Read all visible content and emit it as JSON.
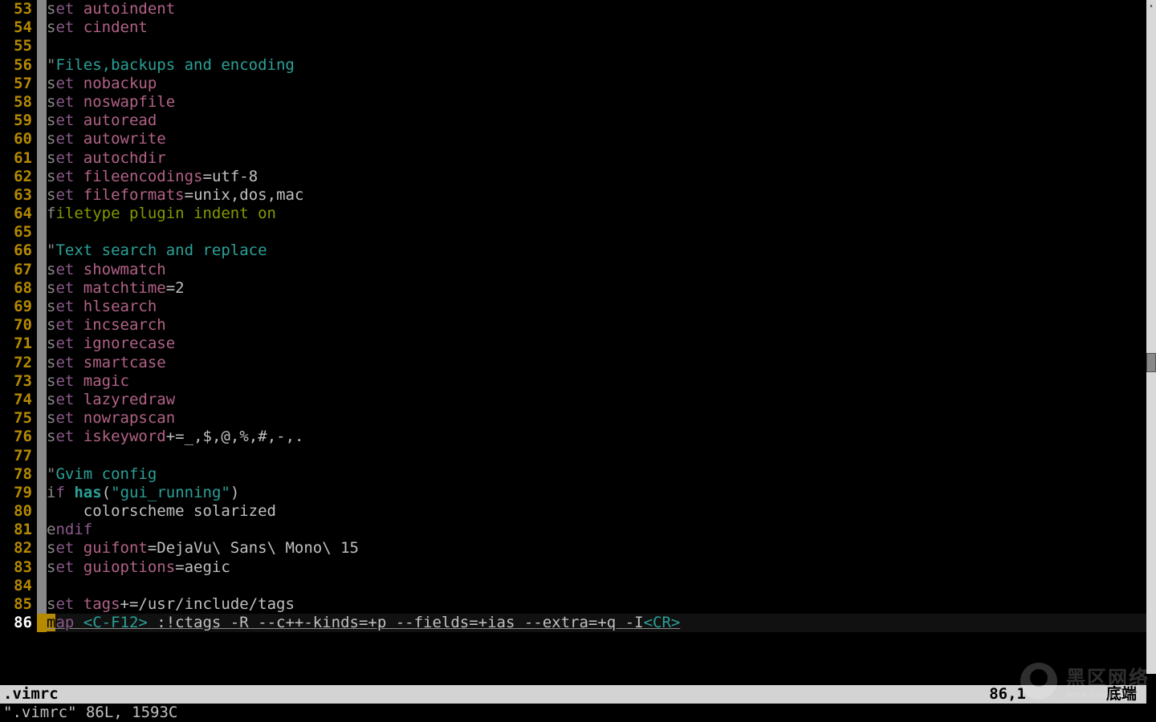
{
  "status": {
    "filename": ".vimrc",
    "position": "86,1",
    "mode": "底端"
  },
  "message": "\".vimrc\" 86L, 1593C",
  "watermark": {
    "line1": "黑区网络",
    "line2": "www.heiqu.com"
  },
  "lines": [
    {
      "n": 53,
      "tokens": [
        [
          "s",
          "fc"
        ],
        [
          "et ",
          "set"
        ],
        [
          "autoindent",
          "option"
        ]
      ]
    },
    {
      "n": 54,
      "tokens": [
        [
          "s",
          "fc"
        ],
        [
          "et ",
          "set"
        ],
        [
          "cindent",
          "option"
        ]
      ]
    },
    {
      "n": 55,
      "tokens": []
    },
    {
      "n": 56,
      "tokens": [
        [
          "\"",
          "fc"
        ],
        [
          "Files,backups and encoding",
          "comment"
        ]
      ]
    },
    {
      "n": 57,
      "tokens": [
        [
          "s",
          "fc"
        ],
        [
          "et ",
          "set"
        ],
        [
          "nobackup",
          "option"
        ]
      ]
    },
    {
      "n": 58,
      "tokens": [
        [
          "s",
          "fc"
        ],
        [
          "et ",
          "set"
        ],
        [
          "noswapfile",
          "option"
        ]
      ]
    },
    {
      "n": 59,
      "tokens": [
        [
          "s",
          "fc"
        ],
        [
          "et ",
          "set"
        ],
        [
          "autoread",
          "option"
        ]
      ]
    },
    {
      "n": 60,
      "tokens": [
        [
          "s",
          "fc"
        ],
        [
          "et ",
          "set"
        ],
        [
          "autowrite",
          "option"
        ]
      ]
    },
    {
      "n": 61,
      "tokens": [
        [
          "s",
          "fc"
        ],
        [
          "et ",
          "set"
        ],
        [
          "autochdir",
          "option"
        ]
      ]
    },
    {
      "n": 62,
      "tokens": [
        [
          "s",
          "fc"
        ],
        [
          "et ",
          "set"
        ],
        [
          "fileencodings",
          "option"
        ],
        [
          "=utf-8",
          "plain"
        ]
      ]
    },
    {
      "n": 63,
      "tokens": [
        [
          "s",
          "fc"
        ],
        [
          "et ",
          "set"
        ],
        [
          "fileformats",
          "option"
        ],
        [
          "=unix",
          "plain"
        ],
        [
          ",",
          "op"
        ],
        [
          "dos",
          "plain"
        ],
        [
          ",",
          "op"
        ],
        [
          "mac",
          "plain"
        ]
      ]
    },
    {
      "n": 64,
      "tokens": [
        [
          "f",
          "fc"
        ],
        [
          "iletype ",
          "filetype"
        ],
        [
          "plugin indent on",
          "filetype"
        ]
      ]
    },
    {
      "n": 65,
      "tokens": []
    },
    {
      "n": 66,
      "tokens": [
        [
          "\"",
          "fc"
        ],
        [
          "Text search and replace",
          "comment"
        ]
      ]
    },
    {
      "n": 67,
      "tokens": [
        [
          "s",
          "fc"
        ],
        [
          "et ",
          "set"
        ],
        [
          "showmatch",
          "option"
        ]
      ]
    },
    {
      "n": 68,
      "tokens": [
        [
          "s",
          "fc"
        ],
        [
          "et ",
          "set"
        ],
        [
          "matchtime",
          "option"
        ],
        [
          "=2",
          "plain"
        ]
      ]
    },
    {
      "n": 69,
      "tokens": [
        [
          "s",
          "fc"
        ],
        [
          "et ",
          "set"
        ],
        [
          "hlsearch",
          "option"
        ]
      ]
    },
    {
      "n": 70,
      "tokens": [
        [
          "s",
          "fc"
        ],
        [
          "et ",
          "set"
        ],
        [
          "incsearch",
          "option"
        ]
      ]
    },
    {
      "n": 71,
      "tokens": [
        [
          "s",
          "fc"
        ],
        [
          "et ",
          "set"
        ],
        [
          "ignorecase",
          "option"
        ]
      ]
    },
    {
      "n": 72,
      "tokens": [
        [
          "s",
          "fc"
        ],
        [
          "et ",
          "set"
        ],
        [
          "smartcase",
          "option"
        ]
      ]
    },
    {
      "n": 73,
      "tokens": [
        [
          "s",
          "fc"
        ],
        [
          "et ",
          "set"
        ],
        [
          "magic",
          "option"
        ]
      ]
    },
    {
      "n": 74,
      "tokens": [
        [
          "s",
          "fc"
        ],
        [
          "et ",
          "set"
        ],
        [
          "lazyredraw",
          "option"
        ]
      ]
    },
    {
      "n": 75,
      "tokens": [
        [
          "s",
          "fc"
        ],
        [
          "et ",
          "set"
        ],
        [
          "nowrapscan",
          "option"
        ]
      ]
    },
    {
      "n": 76,
      "tokens": [
        [
          "s",
          "fc"
        ],
        [
          "et ",
          "set"
        ],
        [
          "iskeyword",
          "option"
        ],
        [
          "+=_",
          "plain"
        ],
        [
          ",",
          "op"
        ],
        [
          "$",
          "plain"
        ],
        [
          ",",
          "op"
        ],
        [
          "@",
          "plain"
        ],
        [
          ",",
          "op"
        ],
        [
          "%",
          "plain"
        ],
        [
          ",",
          "op"
        ],
        [
          "#",
          "plain"
        ],
        [
          ",",
          "op"
        ],
        [
          "-",
          "plain"
        ],
        [
          ",",
          "op"
        ],
        [
          ".",
          "plain"
        ]
      ]
    },
    {
      "n": 77,
      "tokens": []
    },
    {
      "n": 78,
      "tokens": [
        [
          "\"",
          "fc"
        ],
        [
          "Gvim config",
          "comment"
        ]
      ]
    },
    {
      "n": 79,
      "tokens": [
        [
          "i",
          "fc"
        ],
        [
          "f ",
          "set"
        ],
        [
          "has",
          "keyword"
        ],
        [
          "(",
          "plain"
        ],
        [
          "\"gui_running\"",
          "string"
        ],
        [
          ")",
          "plain"
        ]
      ]
    },
    {
      "n": 80,
      "tokens": [
        [
          "    colorscheme ",
          "plain"
        ],
        [
          "solarized",
          "plain"
        ]
      ]
    },
    {
      "n": 81,
      "tokens": [
        [
          "e",
          "fc"
        ],
        [
          "ndif",
          "set"
        ]
      ]
    },
    {
      "n": 82,
      "tokens": [
        [
          "s",
          "fc"
        ],
        [
          "et ",
          "set"
        ],
        [
          "guifont",
          "option"
        ],
        [
          "=DejaVu\\ Sans\\ Mono\\ 15",
          "plain"
        ]
      ]
    },
    {
      "n": 83,
      "tokens": [
        [
          "s",
          "fc"
        ],
        [
          "et ",
          "set"
        ],
        [
          "guioptions",
          "option"
        ],
        [
          "=aegic",
          "plain"
        ]
      ]
    },
    {
      "n": 84,
      "tokens": []
    },
    {
      "n": 85,
      "tokens": [
        [
          "s",
          "fc"
        ],
        [
          "et ",
          "set"
        ],
        [
          "tags",
          "option"
        ],
        [
          "+=/usr/include/tags",
          "plain"
        ]
      ]
    },
    {
      "n": 86,
      "current": true,
      "tokens": [
        [
          "m",
          "fccur"
        ],
        [
          "ap ",
          "set"
        ],
        [
          "<C-F12>",
          "special"
        ],
        [
          " :!ctags -R --c++-kinds=+p --fields=+ias --extra=+q -I",
          "plain"
        ],
        [
          "<CR>",
          "special"
        ]
      ]
    }
  ]
}
